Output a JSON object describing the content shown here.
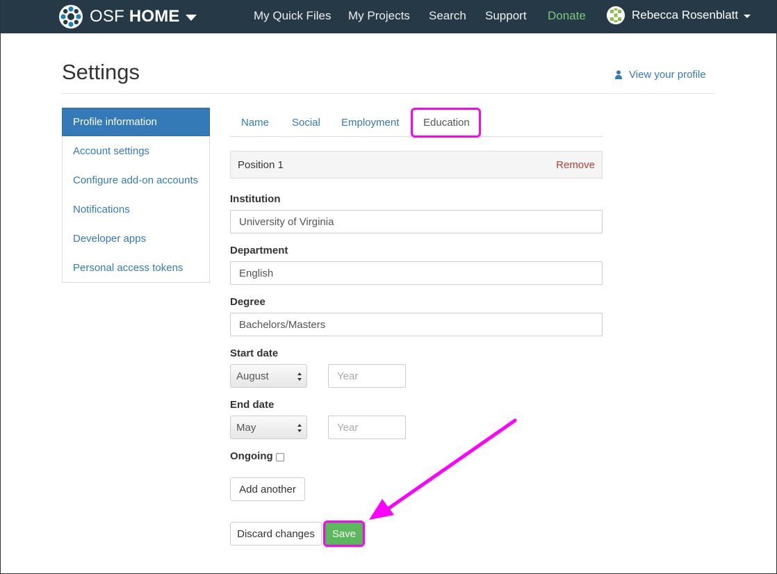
{
  "navbar": {
    "brand_light": "OSF",
    "brand_bold": "HOME",
    "links": [
      "My Quick Files",
      "My Projects",
      "Search",
      "Support",
      "Donate"
    ],
    "user_name": "Rebecca Rosenblatt",
    "background": "#263947",
    "donate_color": "#7ec87e"
  },
  "header": {
    "title": "Settings",
    "view_profile": "View your profile"
  },
  "sidebar": {
    "items": [
      {
        "label": "Profile information",
        "active": true
      },
      {
        "label": "Account settings"
      },
      {
        "label": "Configure add-on accounts"
      },
      {
        "label": "Notifications"
      },
      {
        "label": "Developer apps"
      },
      {
        "label": "Personal access tokens"
      }
    ]
  },
  "tabs": [
    {
      "label": "Name"
    },
    {
      "label": "Social"
    },
    {
      "label": "Employment"
    },
    {
      "label": "Education",
      "active": true
    }
  ],
  "position": {
    "label": "Position 1",
    "remove": "Remove"
  },
  "form": {
    "institution": {
      "label": "Institution",
      "value": "University of Virginia"
    },
    "department": {
      "label": "Department",
      "value": "English"
    },
    "degree": {
      "label": "Degree",
      "value": "Bachelors/Masters"
    },
    "start_date": {
      "label": "Start date",
      "month": "August",
      "year_placeholder": "Year"
    },
    "end_date": {
      "label": "End date",
      "month": "May",
      "year_placeholder": "Year"
    },
    "ongoing": {
      "label": "Ongoing",
      "checked": false
    }
  },
  "buttons": {
    "add_another": "Add another",
    "discard": "Discard changes",
    "save": "Save"
  },
  "colors": {
    "link": "#337ab7",
    "highlight": "#ff00ff",
    "save": "#5cb85c",
    "remove": "#b53d32"
  }
}
